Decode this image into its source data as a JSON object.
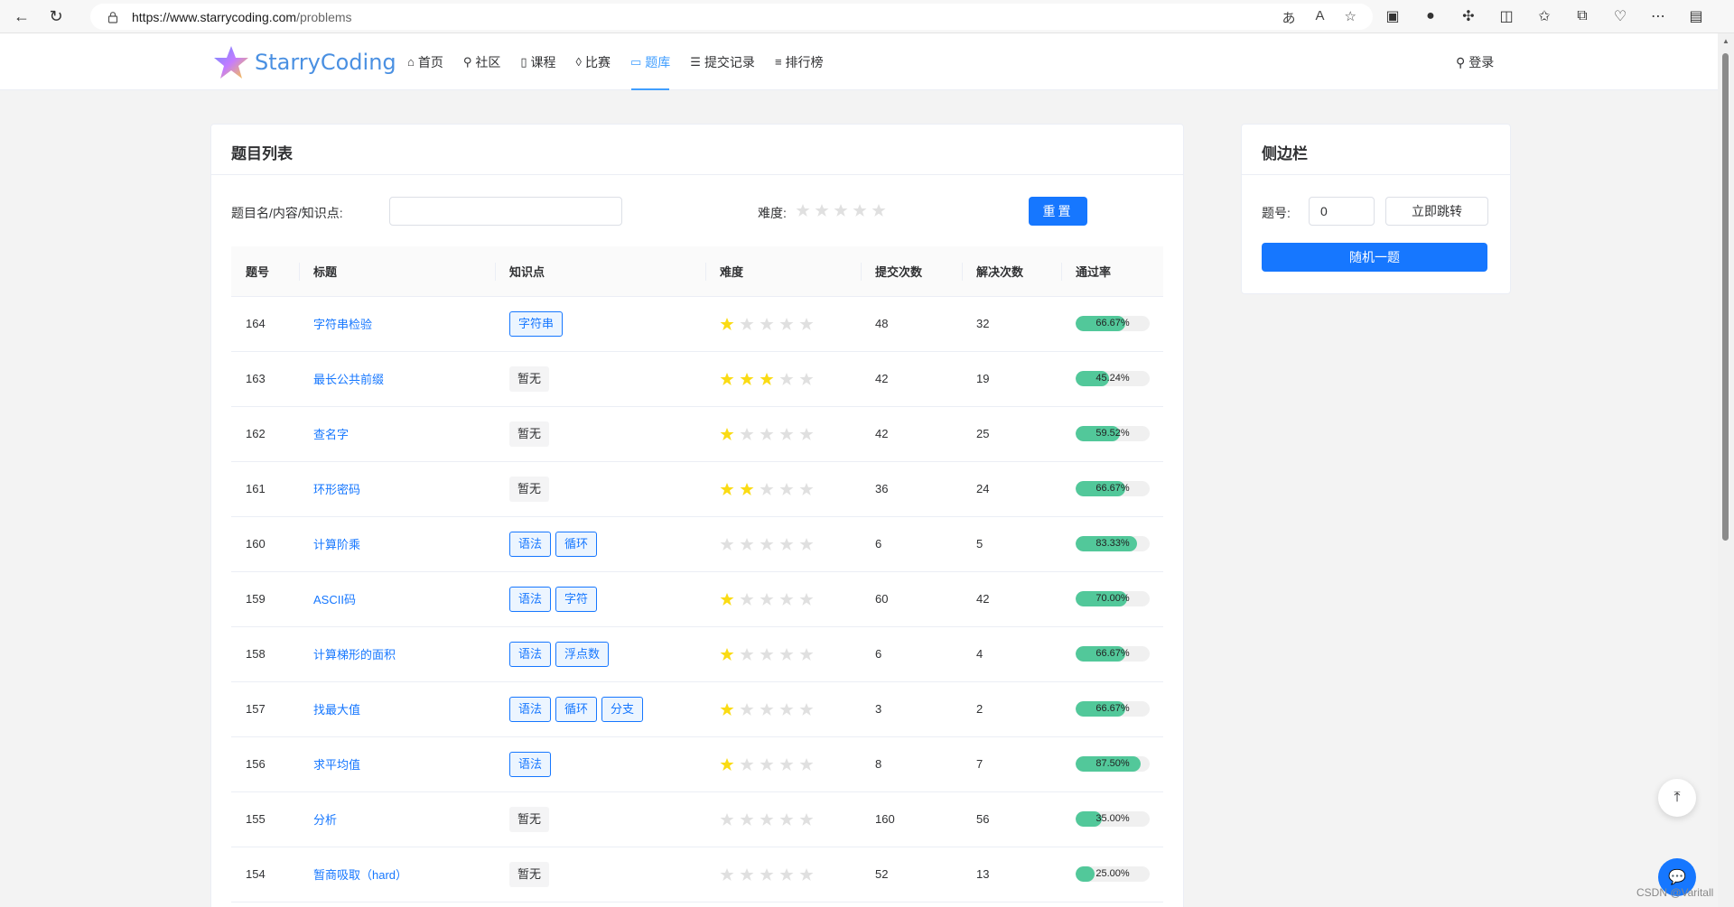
{
  "browser": {
    "url_base": "https://www.starrycoding.com",
    "url_path": "/problems"
  },
  "site": {
    "logo_text": "StarryCoding",
    "menu": [
      {
        "label": "首页",
        "icon": "home-icon"
      },
      {
        "label": "社区",
        "icon": "location-icon"
      },
      {
        "label": "课程",
        "icon": "book-icon"
      },
      {
        "label": "比赛",
        "icon": "fire-icon"
      },
      {
        "label": "题库",
        "icon": "document-icon",
        "active": true
      },
      {
        "label": "提交记录",
        "icon": "list-icon"
      },
      {
        "label": "排行榜",
        "icon": "ranking-icon"
      }
    ],
    "login_label": "登录"
  },
  "problem_list": {
    "title": "题目列表",
    "search_label": "题目名/内容/知识点:",
    "search_value": "",
    "difficulty_label": "难度:",
    "reset_label": "重置",
    "columns": [
      "题号",
      "标题",
      "知识点",
      "难度",
      "提交次数",
      "解决次数",
      "通过率"
    ],
    "rows": [
      {
        "id": "164",
        "title": "字符串检验",
        "tags": [
          "字符串"
        ],
        "difficulty": 1,
        "submit": "48",
        "solved": "32",
        "rate_text": "66.67%",
        "rate": 0.6667
      },
      {
        "id": "163",
        "title": "最长公共前缀",
        "tags": [],
        "difficulty": 3,
        "submit": "42",
        "solved": "19",
        "rate_text": "45.24%",
        "rate": 0.4524
      },
      {
        "id": "162",
        "title": "查名字",
        "tags": [],
        "difficulty": 1,
        "submit": "42",
        "solved": "25",
        "rate_text": "59.52%",
        "rate": 0.5952
      },
      {
        "id": "161",
        "title": "环形密码",
        "tags": [],
        "difficulty": 2,
        "submit": "36",
        "solved": "24",
        "rate_text": "66.67%",
        "rate": 0.6667
      },
      {
        "id": "160",
        "title": "计算阶乘",
        "tags": [
          "语法",
          "循环"
        ],
        "difficulty": 0,
        "submit": "6",
        "solved": "5",
        "rate_text": "83.33%",
        "rate": 0.8333
      },
      {
        "id": "159",
        "title": "ASCII码",
        "tags": [
          "语法",
          "字符"
        ],
        "difficulty": 1,
        "submit": "60",
        "solved": "42",
        "rate_text": "70.00%",
        "rate": 0.7
      },
      {
        "id": "158",
        "title": "计算梯形的面积",
        "tags": [
          "语法",
          "浮点数"
        ],
        "difficulty": 1,
        "submit": "6",
        "solved": "4",
        "rate_text": "66.67%",
        "rate": 0.6667
      },
      {
        "id": "157",
        "title": "找最大值",
        "tags": [
          "语法",
          "循环",
          "分支"
        ],
        "difficulty": 1,
        "submit": "3",
        "solved": "2",
        "rate_text": "66.67%",
        "rate": 0.6667
      },
      {
        "id": "156",
        "title": "求平均值",
        "tags": [
          "语法"
        ],
        "difficulty": 1,
        "submit": "8",
        "solved": "7",
        "rate_text": "87.50%",
        "rate": 0.875
      },
      {
        "id": "155",
        "title": "分析",
        "tags": [],
        "difficulty": 0,
        "submit": "160",
        "solved": "56",
        "rate_text": "35.00%",
        "rate": 0.35
      },
      {
        "id": "154",
        "title": "暂商吸取（hard）",
        "tags": [],
        "difficulty": 0,
        "submit": "52",
        "solved": "13",
        "rate_text": "25.00%",
        "rate": 0.25
      }
    ],
    "no_tag_label": "暂无"
  },
  "sidebar": {
    "title": "侧边栏",
    "number_label": "题号:",
    "number_value": "0",
    "jump_label": "立即跳转",
    "random_label": "随机一题"
  },
  "watermark": "CSDN @Varitall",
  "colors": {
    "primary": "#1677ff",
    "star_on": "#fadb14",
    "star_off": "#e0e0e0",
    "rate_fill": "#52c89a"
  }
}
